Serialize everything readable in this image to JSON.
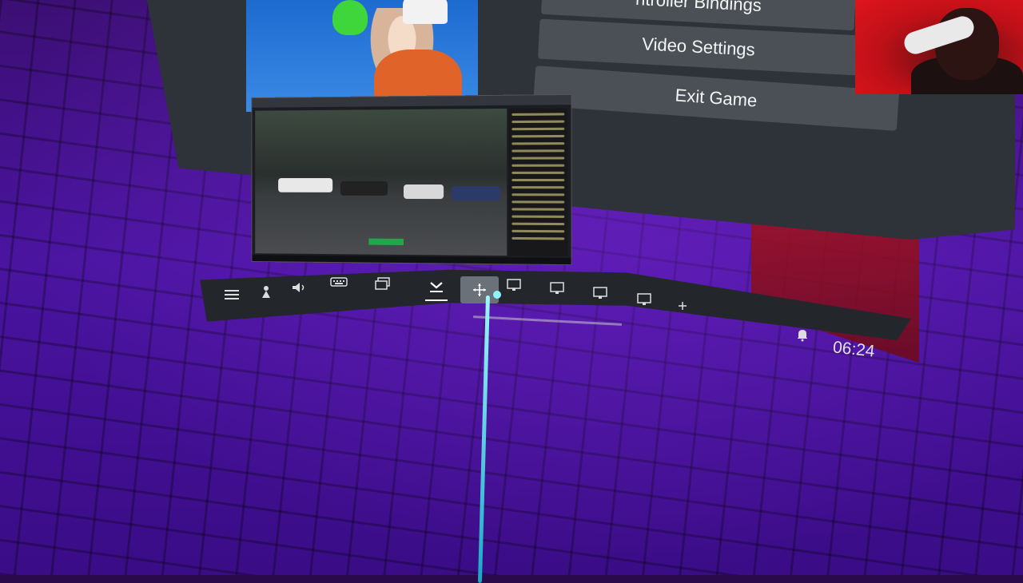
{
  "menu": {
    "buttons": [
      "ntroller Bindings",
      "Video Settings",
      "Exit Game"
    ]
  },
  "dashboard": {
    "icons": [
      {
        "name": "hamburger-menu-icon",
        "glyph": "≡"
      },
      {
        "name": "person-icon",
        "glyph": "♙"
      },
      {
        "name": "volume-icon",
        "glyph": "🔈"
      },
      {
        "name": "keyboard-icon",
        "glyph": "⌨"
      },
      {
        "name": "windows-icon",
        "glyph": "❐"
      },
      {
        "name": "download-icon",
        "glyph": "⤓"
      },
      {
        "name": "move-icon",
        "glyph": "✥"
      },
      {
        "name": "monitor-icon",
        "glyph": "🖵"
      },
      {
        "name": "add-icon",
        "glyph": "+"
      },
      {
        "name": "bell-icon",
        "glyph": "🔔"
      }
    ],
    "clock": "06:24"
  },
  "colors": {
    "panel": "#2d3338",
    "button": "#4a5055",
    "floor": "#4a14a0",
    "laser": "#1aa6c7",
    "webcam_bg": "#c01018"
  }
}
